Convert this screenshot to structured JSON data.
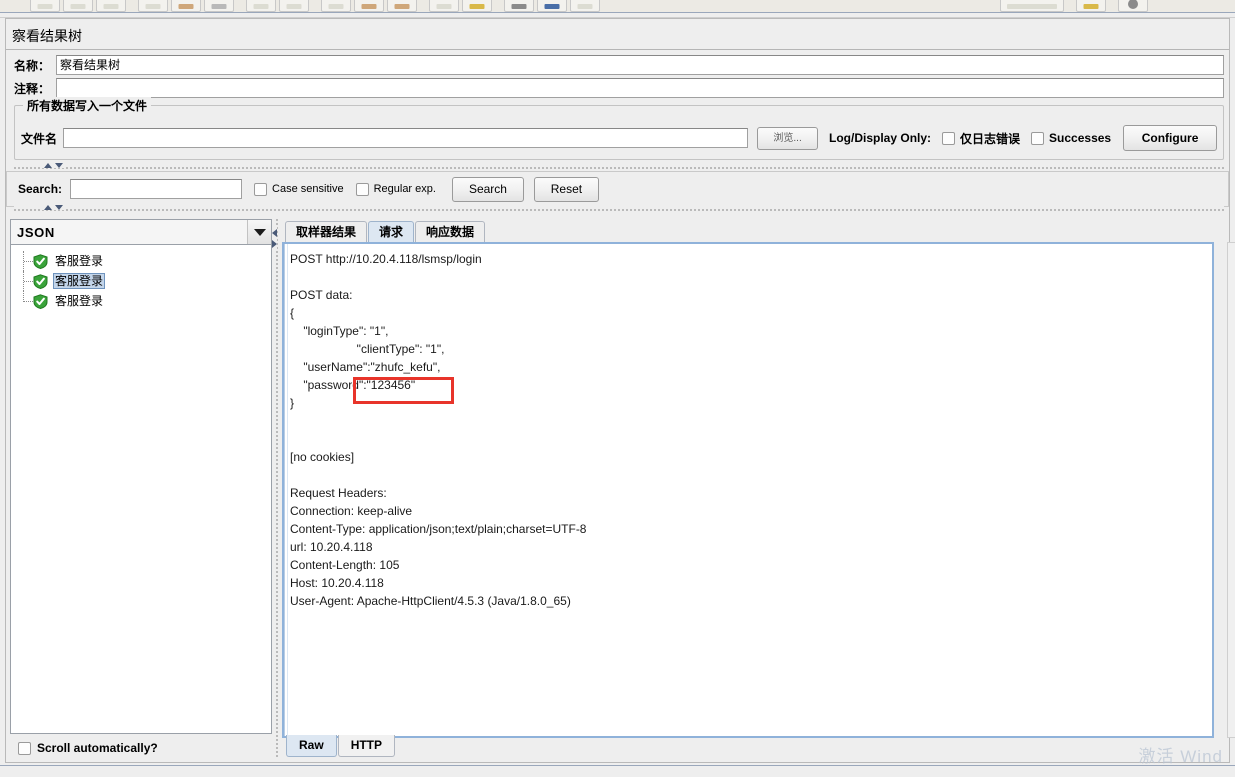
{
  "toolbar": {
    "icons": [
      "new-icon",
      "open-icon",
      "save-icon",
      "sep",
      "cut-icon",
      "copy-icon",
      "paste-icon",
      "sep",
      "expand-icon",
      "collapse-icon",
      "sep",
      "toggle-icon",
      "start-icon",
      "start-no-timers-icon",
      "sep",
      "stop-icon",
      "shutdown-icon",
      "sep",
      "clear-icon",
      "clear-all-icon",
      "sep",
      "search-icon",
      "reset-search-icon",
      "sep",
      "function-helper-icon",
      "help-icon"
    ]
  },
  "panel": {
    "title": "察看结果树",
    "name_label": "名称：",
    "name_value": "察看结果树",
    "comment_label": "注释：",
    "comment_value": ""
  },
  "file_group": {
    "title": "所有数据写入一个文件",
    "filename_label": "文件名",
    "filename_value": "",
    "filename_placeholder": "",
    "browse_label": "浏览...",
    "log_display_only_label": "Log/Display Only:",
    "errors_only_label": "仅日志错误",
    "errors_only_checked": false,
    "successes_label": "Successes",
    "successes_checked": false,
    "configure_label": "Configure"
  },
  "search": {
    "label": "Search:",
    "value": "",
    "placeholder": "",
    "case_sensitive_label": "Case sensitive",
    "case_sensitive_checked": false,
    "regular_exp_label": "Regular exp.",
    "regular_exp_checked": false,
    "search_button": "Search",
    "reset_button": "Reset"
  },
  "left_panel": {
    "renderer_selected": "JSON",
    "tree_items": [
      {
        "label": "客服登录",
        "status": "success",
        "selected": false
      },
      {
        "label": "客服登录",
        "status": "success",
        "selected": true
      },
      {
        "label": "客服登录",
        "status": "success",
        "selected": false
      }
    ],
    "scroll_automatically_label": "Scroll automatically?",
    "scroll_automatically_checked": false
  },
  "right_panel": {
    "tabs": [
      {
        "label": "取样器结果",
        "active": false
      },
      {
        "label": "请求",
        "active": true
      },
      {
        "label": "响应数据",
        "active": false
      }
    ],
    "bottom_tabs": [
      {
        "label": "Raw",
        "active": true
      },
      {
        "label": "HTTP",
        "active": false
      }
    ],
    "request_text": "POST http://10.20.4.118/lsmsp/login\n\nPOST data:\n{\n    \"loginType\": \"1\",\n                    \"clientType\": \"1\",\n    \"userName\":\"zhufc_kefu\",\n    \"password\":\"123456\"\n}\n\n\n[no cookies]\n\nRequest Headers:\nConnection: keep-alive\nContent-Type: application/json;text/plain;charset=UTF-8\nurl: 10.20.4.118\nContent-Length: 105\nHost: 10.20.4.118\nUser-Agent: Apache-HttpClient/4.5.3 (Java/1.8.0_65)",
    "highlight_annotation": "\"zhufc_kefu\"",
    "highlight_color": "#e8342a"
  },
  "watermark": {
    "text": "激活 Wind"
  },
  "colors": {
    "accent": "#8fb2da",
    "selection": "#c3d5ea",
    "tab_active": "#dde7f2",
    "success": "#3aa33a",
    "panel_bg": "#eeeeee"
  }
}
